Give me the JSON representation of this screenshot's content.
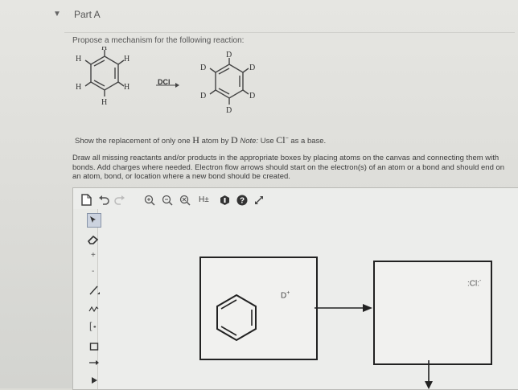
{
  "header": {
    "caret": "▼",
    "part_label": "Part A"
  },
  "question": {
    "prompt": "Propose a mechanism for the following reaction:",
    "reactant_atoms": [
      "H",
      "H",
      "H",
      "H",
      "H",
      "H"
    ],
    "product_atoms": [
      "D",
      "D",
      "D",
      "D",
      "D",
      "D"
    ],
    "reagent": "DCl",
    "note_prefix": "Show the replacement of only one",
    "note_h": "H",
    "note_mid": "atom by",
    "note_d": "D",
    "note_label": "Note:",
    "note_use": "Use",
    "note_cl": "Cl",
    "note_suffix": "as a base.",
    "instructions": "Draw all missing reactants and/or products in the appropriate boxes by placing atoms on the canvas and connecting them with bonds. Add charges where needed. Electron flow arrows should start on the electron(s) of an atom or a bond and should end on an atom, bond, or location where a new bond should be created."
  },
  "toolbar": {
    "hplus": "H±"
  },
  "left_tools": {
    "plus": "+",
    "minus": "-",
    "bracket": "[",
    "dots": "••"
  },
  "canvas": {
    "box1_label": "D",
    "box1_charge": "+",
    "box2_label": ":Cl:",
    "box2_charge": "-"
  }
}
